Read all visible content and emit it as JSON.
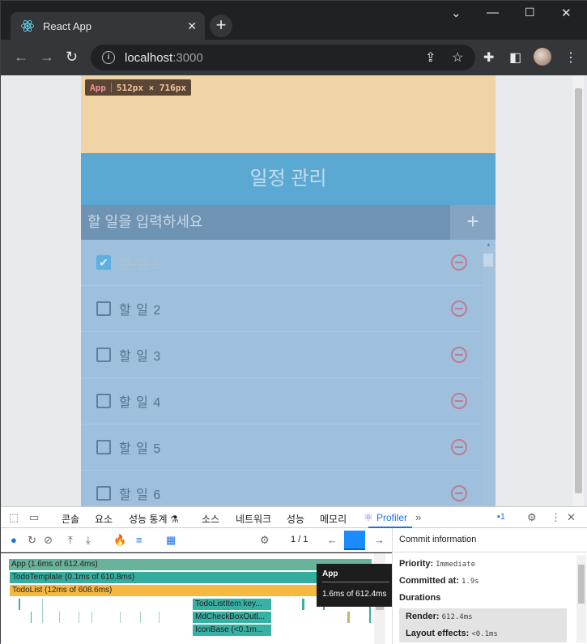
{
  "browser": {
    "tab_title": "React App",
    "url_host": "localhost",
    "url_port": ":3000"
  },
  "overlay": {
    "component": "App",
    "size": "512px × 716px"
  },
  "todo": {
    "title": "일정 관리",
    "placeholder": "할 일을 입력하세요",
    "add_label": "+",
    "items": [
      {
        "text": "할 일 1",
        "checked": true
      },
      {
        "text": "할 일 2",
        "checked": false
      },
      {
        "text": "할 일 3",
        "checked": false
      },
      {
        "text": "할 일 4",
        "checked": false
      },
      {
        "text": "할 일 5",
        "checked": false
      },
      {
        "text": "할 일 6",
        "checked": false
      }
    ]
  },
  "devtools": {
    "tabs": [
      "콘솔",
      "요소",
      "성능 통계 ⚗",
      "소스",
      "네트워크",
      "성능",
      "메모리",
      "Profiler"
    ],
    "active_tab": "Profiler",
    "issues_count": "1",
    "commit_index": "1",
    "commit_total": "1",
    "commit_sep": "/",
    "flame": [
      {
        "label": "App (1.6ms of 612.4ms)",
        "color": "#68b39a"
      },
      {
        "label": "TodoTemplate (0.1ms of 610.8ms)",
        "color": "#35ad9e"
      },
      {
        "label": "TodoList (12ms of 608.6ms)",
        "color": "#f6b940"
      },
      {
        "label": "TodoListItem key...",
        "color": "#37b1a3"
      },
      {
        "label": "MdCheckBoxOutl...",
        "color": "#37b1a3"
      },
      {
        "label": "IconBase (<0.1m...",
        "color": "#37b1a3"
      }
    ],
    "tooltip": {
      "name": "App",
      "value": "1.6ms of 612.4ms"
    },
    "commit_info": {
      "header": "Commit information",
      "priority_label": "Priority:",
      "priority_value": "Immediate",
      "committed_label": "Committed at:",
      "committed_value": "1.9s",
      "durations_label": "Durations",
      "render_label": "Render:",
      "render_value": "612.4ms",
      "layout_label": "Layout effects:",
      "layout_value": "<0.1ms"
    }
  }
}
